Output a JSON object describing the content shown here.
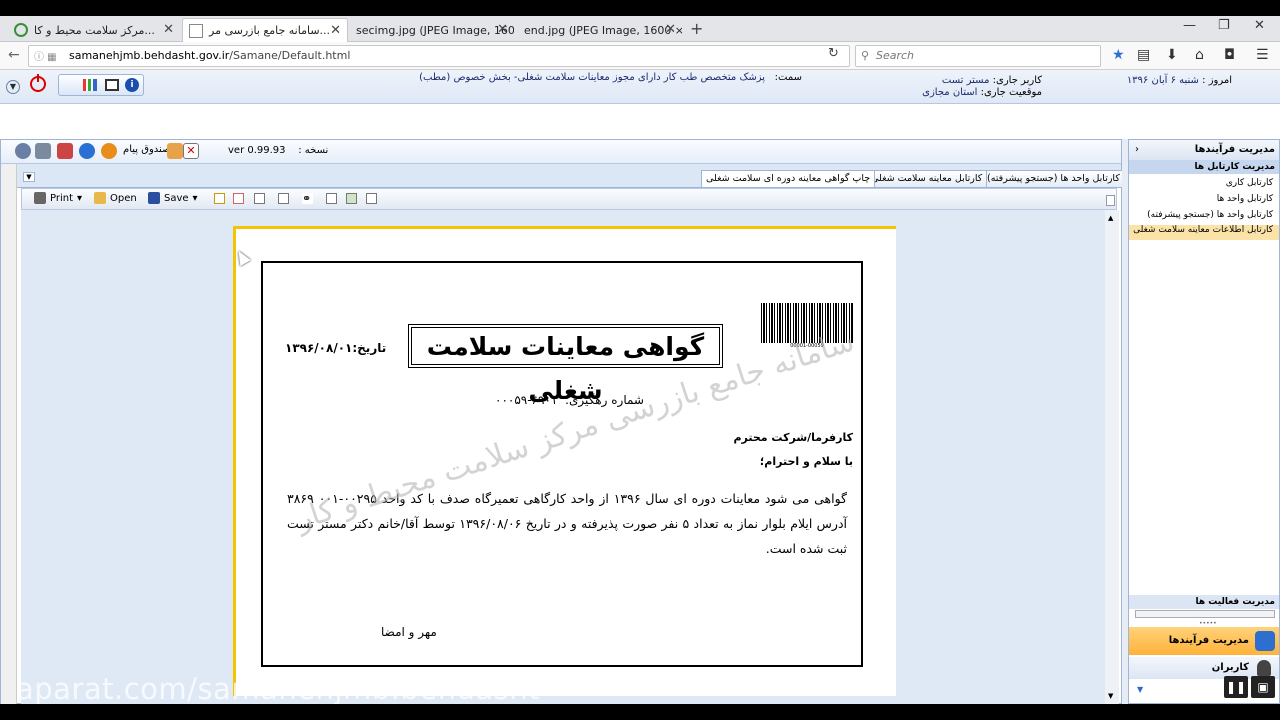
{
  "browser": {
    "tabs": [
      {
        "label": "مرکز سلامت محیط و کا...",
        "active": false
      },
      {
        "label": "سامانه جامع بازرسی مر...",
        "active": true
      },
      {
        "label": "secimg.jpg (JPEG Image, 1600 ...",
        "active": false
      },
      {
        "label": "end.jpg (JPEG Image, 1600 × 8...",
        "active": false
      }
    ],
    "url_host": "samanehjmb.behdasht.gov.ir",
    "url_path": "/Samane/Default.html",
    "search_placeholder": "Search"
  },
  "header": {
    "today_label": "امروز :",
    "today_value": "شنبه ۶ آبان ۱۳۹۶",
    "user_label": "کاربر جاری:",
    "user_value": "مستر تست",
    "location_label": "موقعیت جاری:",
    "location_value": "استان مجازی",
    "role_label": "سمت:",
    "role_value": "پزشک متخصص طب کار دارای مجوز معاینات سلامت شغلی- بخش خصوص (مطب)"
  },
  "main": {
    "version_label": "نسخه :",
    "version_value": "ver 0.99.93",
    "message_box": "صندوق پیام",
    "tabs": [
      "کارتابل واحد ها (جستجو پیشرفته)",
      "کارتابل معاینه سلامت شغلی",
      "چاپ گواهی معاینه دوره ای سلامت شغلی"
    ],
    "report_toolbar": {
      "print": "Print",
      "open": "Open",
      "save": "Save"
    }
  },
  "certificate": {
    "title": "گواهی معاینات سلامت شغلی",
    "date_label": "تاریخ:",
    "date_value": "۱۳۹۶/۰۸/۰۱",
    "barcode_number": "00001-00059",
    "tracking_label": "شماره رهگیری:",
    "tracking_value": "۶۹۰۱-۰۰۰۵۹",
    "salutation_1": "کارفرما/شرکت محترم",
    "salutation_2": "با سلام و احترام؛",
    "body": "گواهی می شود معاینات دوره ای سال ۱۳۹۶ از واحد کارگاهی تعمیرگاه صدف با کد واحد ۰۰۲۹۵-۰۰۱ ۳۸۶۹ آدرس ایلام بلوار نماز به تعداد ۵ نفر صورت پذیرفته و در تاریخ ۱۳۹۶/۰۸/۰۶ توسط آقا/خانم دکتر مستر تست ثبت شده است.",
    "signature": "مهر و امضا",
    "watermark": "سامانه جامع بازرسی مرکز سلامت محیط و کار"
  },
  "sidebar": {
    "header": "مدیریت فرآیندها",
    "section": "مدیریت کارتابل ها",
    "items": [
      "کارتابل کاری",
      "کارتابل واحد ها",
      "کارتابل واحد ها (جستجو پیشرفته)",
      "کارتابل اطلاعات معاینه سلامت شغلی"
    ],
    "activities": "مدیریت فعالیت ها",
    "process_mgmt": "مدیریت فرآیندها",
    "users": "کاربران"
  },
  "overlay": {
    "watermark_text": "aparat.com/samanehjmb.behdasht"
  }
}
